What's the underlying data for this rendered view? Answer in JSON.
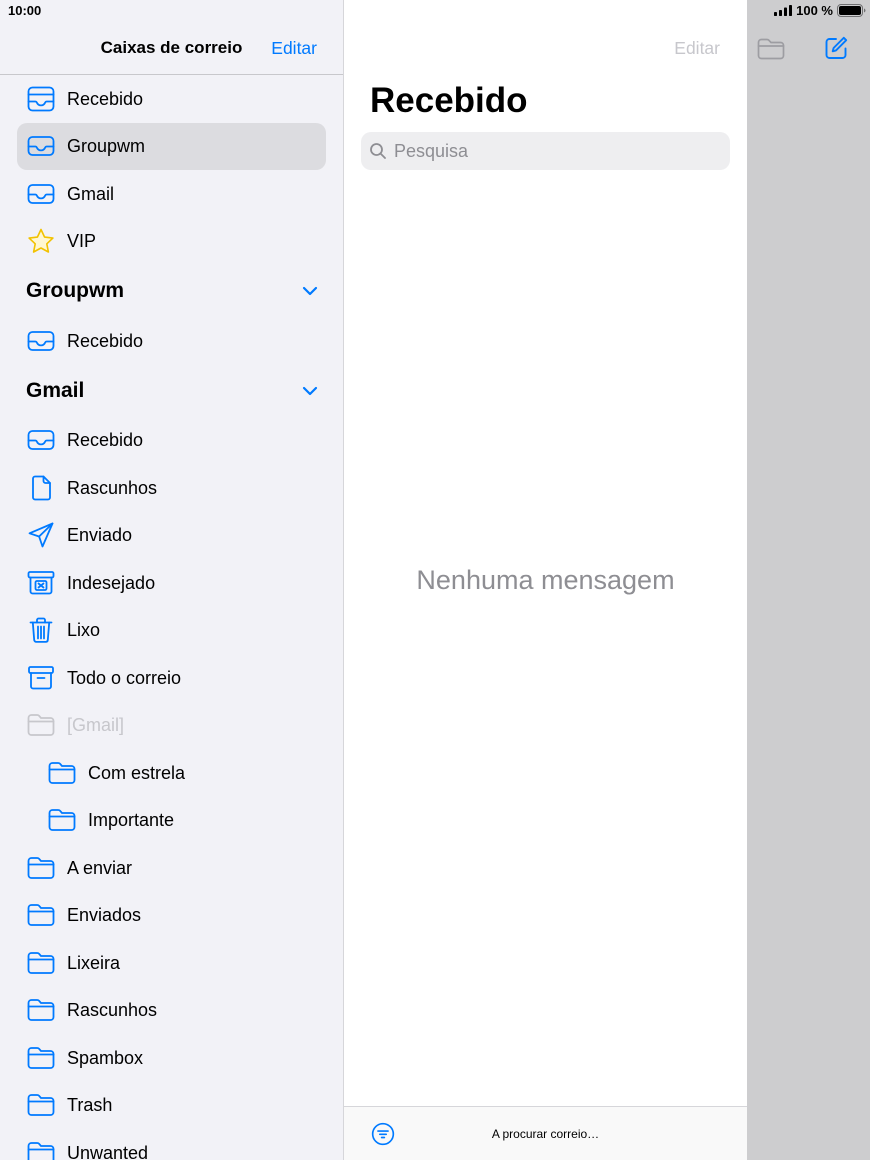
{
  "status_bar": {
    "time": "10:00",
    "battery": "100 %",
    "battery_level": 1.0
  },
  "sidebar": {
    "title": "Caixas de correio",
    "edit_label": "Editar",
    "favorites": [
      {
        "label": "Recebido",
        "icon": "all-inboxes-icon"
      },
      {
        "label": "Groupwm",
        "icon": "inbox-icon",
        "selected": true
      },
      {
        "label": "Gmail",
        "icon": "inbox-icon"
      },
      {
        "label": "VIP",
        "icon": "star-icon"
      }
    ],
    "accounts": [
      {
        "name": "Groupwm",
        "expanded": true,
        "mailboxes": [
          {
            "label": "Recebido",
            "icon": "inbox-icon"
          }
        ]
      },
      {
        "name": "Gmail",
        "expanded": true,
        "mailboxes": [
          {
            "label": "Recebido",
            "icon": "inbox-icon"
          },
          {
            "label": "Rascunhos",
            "icon": "document-icon"
          },
          {
            "label": "Enviado",
            "icon": "paper-plane-icon"
          },
          {
            "label": "Indesejado",
            "icon": "junk-icon"
          },
          {
            "label": "Lixo",
            "icon": "trash-icon"
          },
          {
            "label": "Todo o correio",
            "icon": "archive-icon"
          },
          {
            "label": "[Gmail]",
            "icon": "folder-icon",
            "disabled": true
          },
          {
            "label": "Com estrela",
            "icon": "folder-icon",
            "level": 1
          },
          {
            "label": "Importante",
            "icon": "folder-icon",
            "level": 1
          },
          {
            "label": "A enviar",
            "icon": "folder-icon"
          },
          {
            "label": "Enviados",
            "icon": "folder-icon"
          },
          {
            "label": "Lixeira",
            "icon": "folder-icon"
          },
          {
            "label": "Rascunhos",
            "icon": "folder-icon"
          },
          {
            "label": "Spambox",
            "icon": "folder-icon"
          },
          {
            "label": "Trash",
            "icon": "folder-icon"
          },
          {
            "label": "Unwanted",
            "icon": "folder-icon"
          }
        ]
      }
    ]
  },
  "message_list": {
    "edit_label": "Editar",
    "edit_enabled": false,
    "title": "Recebido",
    "search": {
      "placeholder": "Pesquisa",
      "value": ""
    },
    "empty_text": "Nenhuma mensagem",
    "toolbar": {
      "filter_icon": "filter-icon",
      "status_text": "A procurar correio…"
    }
  },
  "detail": {
    "toolbar": {
      "move_icon": "folder-icon",
      "compose_icon": "compose-icon"
    }
  },
  "colors": {
    "accent": "#007aff",
    "sidebar_background": "#f2f2f7",
    "selection": "#dcdce0",
    "secondary_text": "#8e8e93",
    "disabled": "#c7c7cc",
    "star": "#f2c200",
    "dimmed_pane": "#cdcdcf"
  }
}
